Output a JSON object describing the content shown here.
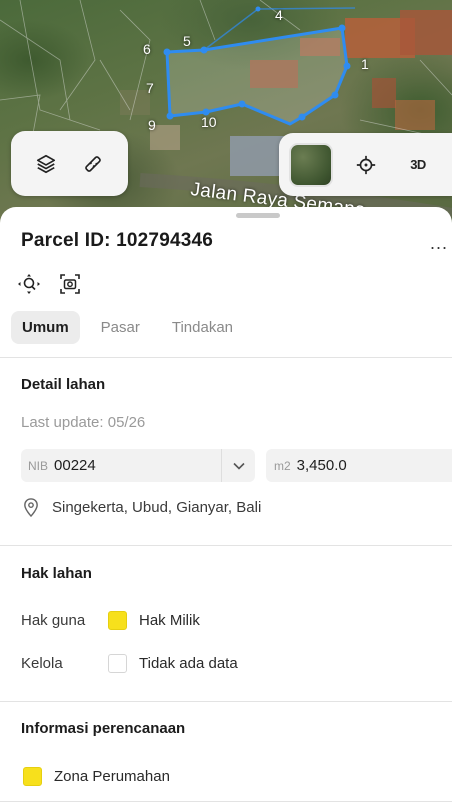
{
  "map": {
    "road_label": "Jalan Raya Semana",
    "vertex_labels": [
      "1",
      "4",
      "5",
      "6",
      "7",
      "9",
      "10"
    ],
    "buttons": {
      "view_3d_label": "3D"
    },
    "icons": [
      "layers-icon",
      "measure-icon",
      "satellite-thumbnail",
      "locate-icon"
    ],
    "parcel_outline_color": "#2f8cf0"
  },
  "parcel": {
    "title": "Parcel ID: 102794346",
    "more_label": "..."
  },
  "tabs": [
    {
      "label": "Umum",
      "active": true
    },
    {
      "label": "Pasar",
      "active": false
    },
    {
      "label": "Tindakan",
      "active": false
    }
  ],
  "detail": {
    "heading": "Detail lahan",
    "last_update": "Last update: 05/26",
    "nib_prefix": "NIB",
    "nib_value": "00224",
    "area_prefix": "m2",
    "area_value": "3,450.0",
    "location": "Singekerta, Ubud, Gianyar, Bali"
  },
  "rights": {
    "heading": "Hak lahan",
    "rows": [
      {
        "label": "Hak guna",
        "value": "Hak Milik",
        "swatch_color": "#f7e01c"
      },
      {
        "label": "Kelola",
        "value": "Tidak ada data",
        "swatch_color": "#ffffff"
      }
    ]
  },
  "planning": {
    "heading": "Informasi perencanaan",
    "zone": "Zona Perumahan",
    "zone_color": "#f7e01c"
  }
}
